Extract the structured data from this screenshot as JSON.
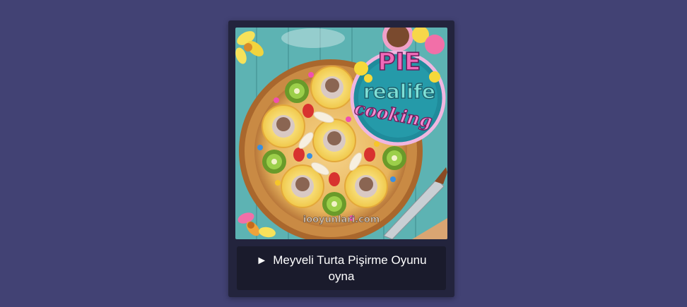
{
  "game_card": {
    "logo": {
      "line1": "PIE",
      "line2": "realife",
      "line3": "cooking"
    },
    "watermark": "iooyunlari.com",
    "play_icon": "►",
    "play_label": "Meyveli Turta Pişirme Oyunu oyna"
  },
  "colors": {
    "page_background": "#424274",
    "card_background": "#23243d",
    "button_background": "#1a1b2c",
    "button_text": "#ffffff",
    "table_teal": "#5fb3b0",
    "crust": "#b77a3c"
  }
}
